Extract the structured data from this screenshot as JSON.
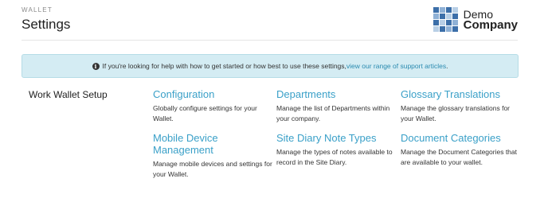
{
  "header": {
    "eyebrow": "WALLET",
    "title": "Settings",
    "logo": {
      "line1": "Demo",
      "line2": "Company"
    }
  },
  "banner": {
    "icon": "info-icon",
    "text": "If you're looking for help with how to get started or how best to use these settings, ",
    "link": "view our range of support articles",
    "suffix": "."
  },
  "section": {
    "label": "Work Wallet Setup"
  },
  "cards": [
    {
      "title": "Configuration",
      "desc": "Globally configure settings for your Wallet."
    },
    {
      "title": "Departments",
      "desc": "Manage the list of Departments within your company."
    },
    {
      "title": "Glossary Translations",
      "desc": "Manage the glossary translations for your Wallet."
    },
    {
      "title": "Mobile Device Management",
      "desc": "Manage mobile devices and settings for your Wallet."
    },
    {
      "title": "Site Diary Note Types",
      "desc": "Manage the types of notes available to record in the Site Diary."
    },
    {
      "title": "Document Categories",
      "desc": "Manage the Document Categories that are available to your wallet."
    }
  ],
  "colors": {
    "accent": "#3aa0c8",
    "banner_bg": "#d4ecf3"
  }
}
